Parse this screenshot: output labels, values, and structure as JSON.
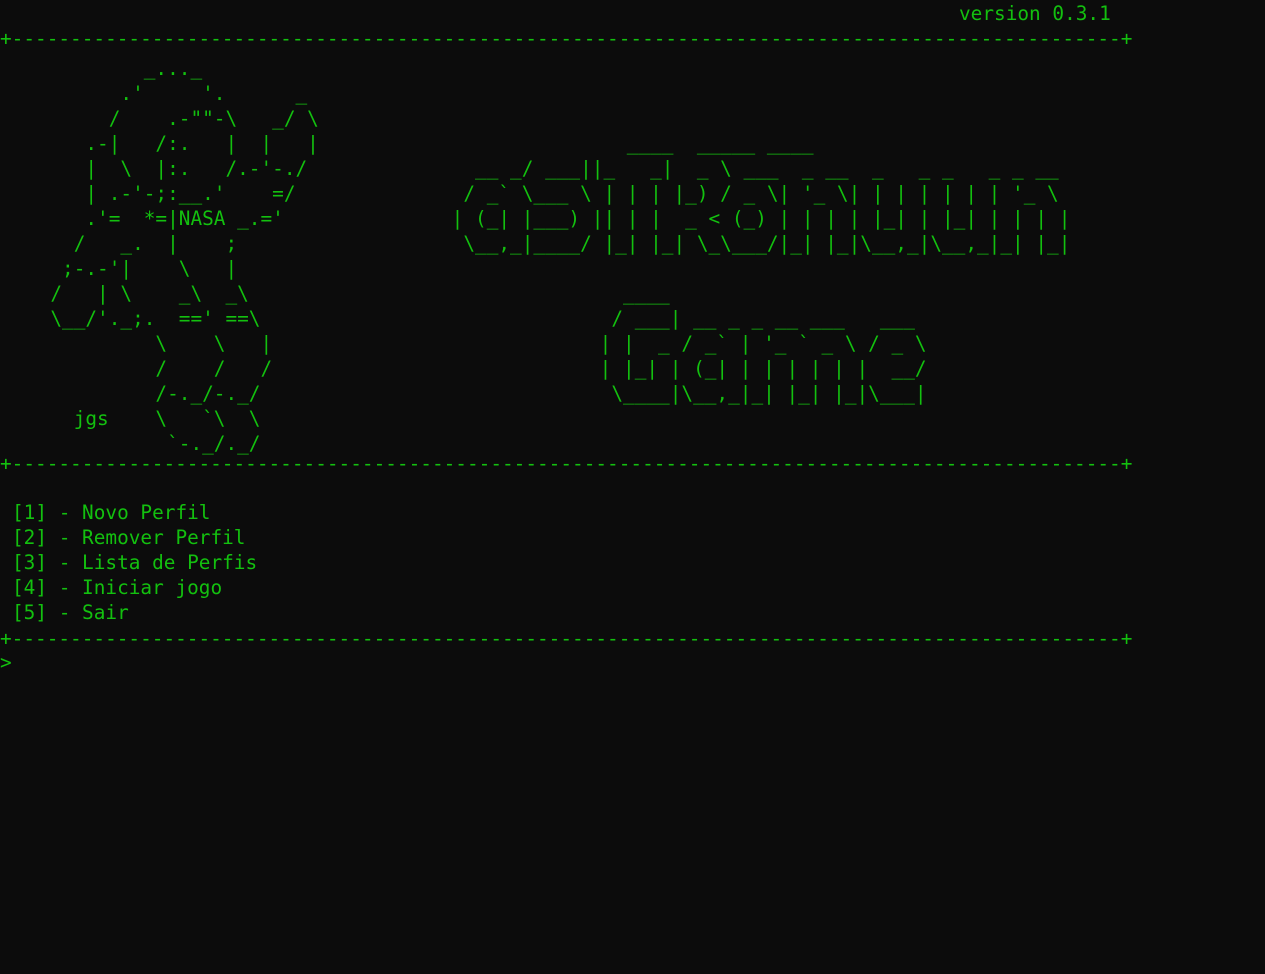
{
  "header": {
    "version": "version 0.3.1"
  },
  "rules": {
    "top": "+-----------------------------------------------------------------------------------------------+",
    "middle": "+-----------------------------------------------------------------------------------------------+",
    "bottom": "+-----------------------------------------------------------------------------------------------+"
  },
  "art": {
    "astronaut": "          _..._\n        .'     '.      _\n       /    .-\"\"-\\   _/ \\\n     .-|   /:.   |  |   |\n     |  \\  |:.   /.-'-./\n     | .-'-;:__.'    =/\n     .'=  *=|NASA _.='\n    /   _.  |    ;\n   ;-.-'|    \\   |\n  /   | \\    _\\  _\\\n  \\__/'._;.  ==' ==\\\n           \\    \\   |\n           /    /   /\n           /-._/-._/\n    jgs    \\   `\\  \\\n            `-._/._/",
    "title_line1": "                ____  _____ ____\n   __ _/ ___||_   _|  _ \\ ___  _ __  _   _ _   _ _ __\n  / _` \\___ \\ | | | |_) / _ \\| '_ \\| | | | | | | '_ \\\n | (_| |___) || | |  _ < (_) | | | | |_| | |_| | | | |\n  \\__,_|____/ |_| |_| \\_\\___/|_| |_|\\__,_|\\__,_|_| |_|",
    "title_line2": "   ____\n  / ___| __ _ _ __ ___   ___\n | |  _ / _` | '_ ` _ \\ / _ \\\n | |_| | (_| | | | | | |  __/\n  \\____|\\__,_|_| |_| |_|\\___|"
  },
  "menu": {
    "items": [
      "[1] - Novo Perfil",
      "[2] - Remover Perfil",
      "[3] - Lista de Perfis",
      "[4] - Iniciar jogo",
      "[5] - Sair"
    ]
  },
  "prompt": {
    "symbol": ">",
    "value": ""
  }
}
